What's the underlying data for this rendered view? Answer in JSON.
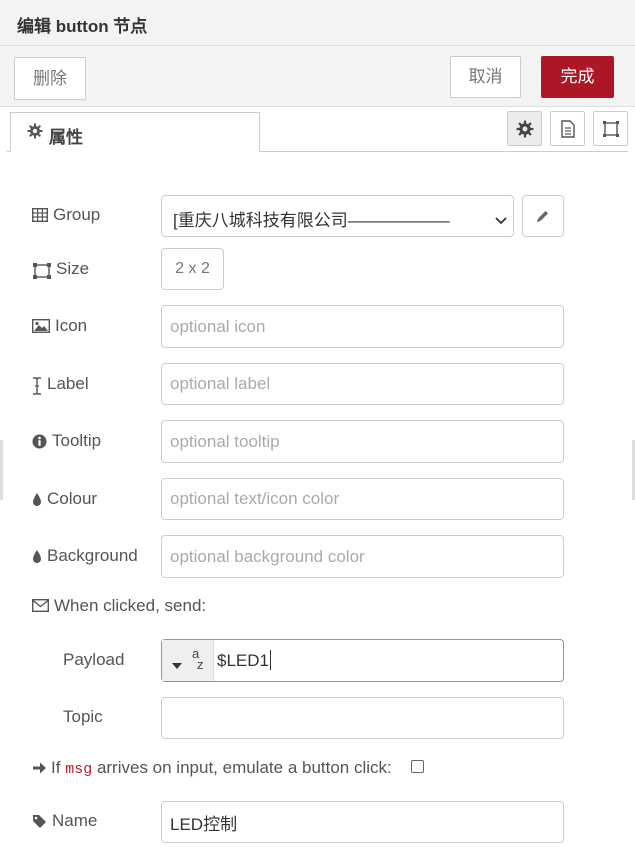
{
  "dialog": {
    "title": "编辑 button 节点"
  },
  "toolbar": {
    "delete_label": "删除",
    "cancel_label": "取消",
    "done_label": "完成"
  },
  "tabs": {
    "properties_label": "属性"
  },
  "fields": {
    "group": {
      "label": "Group",
      "value": "[重庆八城科技有限公司——————"
    },
    "size": {
      "label": "Size",
      "value": "2 x 2"
    },
    "icon": {
      "label": "Icon",
      "placeholder": "optional icon"
    },
    "label": {
      "label": "Label",
      "placeholder": "optional label"
    },
    "tooltip": {
      "label": "Tooltip",
      "placeholder": "optional tooltip"
    },
    "colour": {
      "label": "Colour",
      "placeholder": "optional text/icon color"
    },
    "background": {
      "label": "Background",
      "placeholder": "optional background color"
    },
    "when_clicked": {
      "label": "When clicked, send:"
    },
    "payload": {
      "label": "Payload",
      "type_glyph_top": "a",
      "type_glyph_bottom": "z",
      "value": "$LED1"
    },
    "topic": {
      "label": "Topic",
      "value": ""
    },
    "emulate": {
      "prefix": "If",
      "code": "msg",
      "suffix": "arrives on input, emulate a button click:",
      "checked": false
    },
    "name": {
      "label": "Name",
      "value": "LED控制"
    }
  },
  "colors": {
    "primary": "#ad1625",
    "focus_border": "#6aa7a7"
  }
}
